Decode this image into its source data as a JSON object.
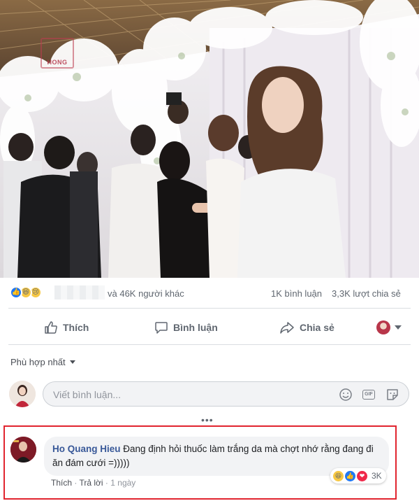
{
  "photo": {
    "watermark": "HONG",
    "description_icon": "wedding-photo"
  },
  "stats": {
    "reactions": [
      "like",
      "haha",
      "sad"
    ],
    "others_text": "và 46K người khác",
    "comments_text": "1K bình luận",
    "shares_text": "3,3K lượt chia sẻ"
  },
  "actions": {
    "like_label": "Thích",
    "comment_label": "Bình luận",
    "share_label": "Chia sẻ"
  },
  "sort": {
    "label": "Phù hợp nhất"
  },
  "composer": {
    "placeholder": "Viết bình luận..."
  },
  "more": "•••",
  "comment": {
    "author": "Ho Quang Hieu",
    "text": "Đang định hỏi thuốc làm trắng da mà chợt nhớ rằng đang đi ăn đám cưới =)))))",
    "like_link": "Thích",
    "reply_link": "Trả lời",
    "separator": "·",
    "time": "1 ngày",
    "reaction_count": "3K",
    "reactions": [
      "haha",
      "like",
      "love"
    ]
  },
  "colors": {
    "link_blue": "#385898",
    "like_blue": "#2078f4",
    "highlight_red": "#e1252f",
    "text_gray": "#606770"
  }
}
